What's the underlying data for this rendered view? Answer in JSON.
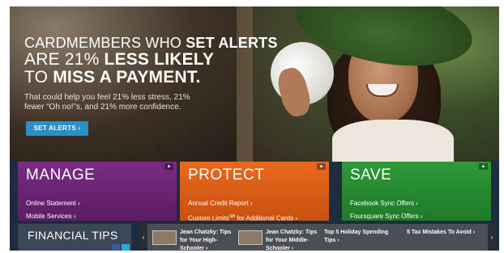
{
  "hero": {
    "headline_line1_prefix": "CARDMEMBERS WHO ",
    "headline_line1_bold": "SET ALERTS",
    "headline_line2_prefix": "ARE 21% ",
    "headline_line2_bold": "LESS LIKELY",
    "headline_line3_prefix": "TO ",
    "headline_line3_bold": "MISS A PAYMENT.",
    "subtext": "That could help you feel 21% less stress, 21% fewer “Oh no!”s, and 21% more confidence.",
    "cta_label": "SET ALERTS ›"
  },
  "panels": [
    {
      "title": "MANAGE",
      "links": [
        "Online Statement ›",
        "Mobile Services ›"
      ]
    },
    {
      "title": "PROTECT",
      "links": [
        "Annual Credit Report ›",
        "Custom Limits",
        "SM",
        " for Additional Cards ›"
      ]
    },
    {
      "title": "SAVE",
      "links": [
        "Facebook Sync Offers ›",
        "Foursquare Sync Offers ›"
      ]
    }
  ],
  "financial_tips": {
    "title": "FINANCIAL TIPS"
  },
  "carousel": {
    "prev": "‹",
    "next": "›",
    "items": [
      {
        "text": "Jean Chatzky: Tips for Your High-Schooler ›"
      },
      {
        "text": "Jean Chatzky: Tips for Your Middle-Schooler ›"
      },
      {
        "text": "Top 5 Holiday Spending Tips ›"
      },
      {
        "text": "5 Tax Mistakes To Avoid ›"
      }
    ]
  },
  "colors": {
    "manage": "#7b2b86",
    "protect": "#e96a1e",
    "save": "#2f9a3a",
    "cta": "#2a8fc4"
  }
}
